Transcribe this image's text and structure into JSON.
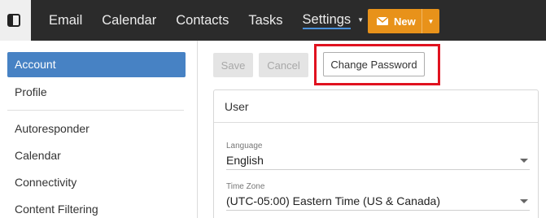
{
  "nav": {
    "items": [
      {
        "label": "Email"
      },
      {
        "label": "Calendar"
      },
      {
        "label": "Contacts"
      },
      {
        "label": "Tasks"
      }
    ],
    "active_label": "Settings",
    "new_label": "New"
  },
  "sidebar": {
    "items": [
      {
        "label": "Account",
        "active": true
      },
      {
        "label": "Profile"
      },
      {
        "label": "Autoresponder"
      },
      {
        "label": "Calendar"
      },
      {
        "label": "Connectivity"
      },
      {
        "label": "Content Filtering"
      }
    ]
  },
  "toolbar": {
    "save_label": "Save",
    "cancel_label": "Cancel",
    "change_password_label": "Change Password"
  },
  "panel": {
    "title": "User",
    "language_label": "Language",
    "language_value": "English",
    "timezone_label": "Time Zone",
    "timezone_value": "(UTC-05:00) Eastern Time (US & Canada)"
  },
  "colors": {
    "accent": "#4782c4",
    "new_button": "#e8921a",
    "highlight": "#e0121f"
  }
}
